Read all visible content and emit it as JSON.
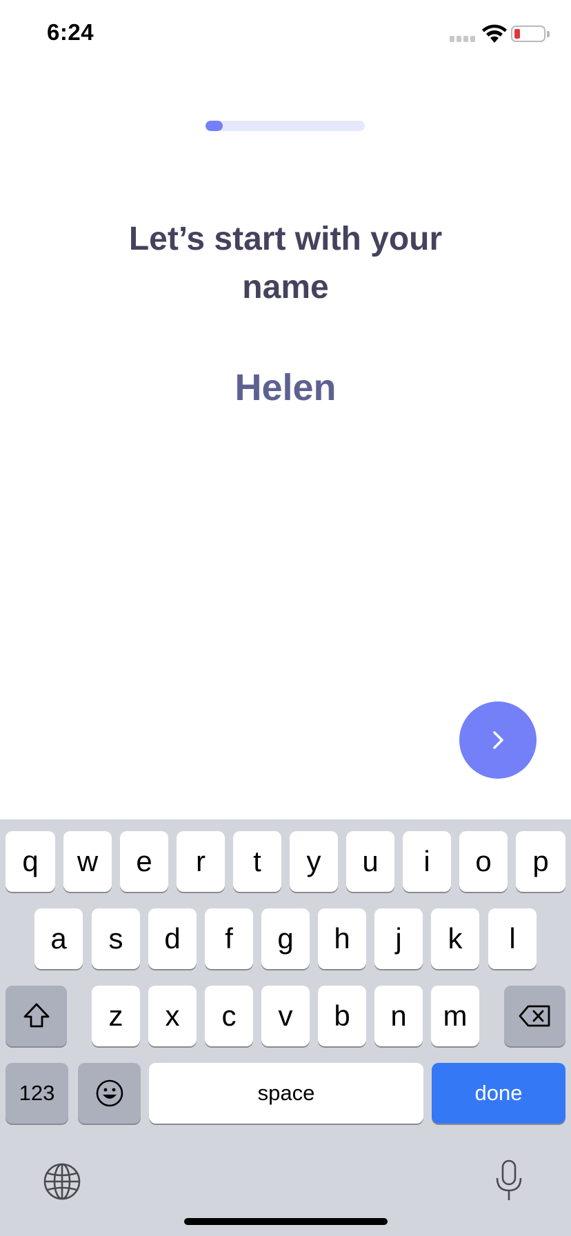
{
  "status_bar": {
    "time": "6:24"
  },
  "onboarding": {
    "progress_fraction": 0.11,
    "headline": "Let’s start with your name",
    "name_value": "Helen"
  },
  "colors": {
    "accent": "#7480f7",
    "progress_track": "#e6e8fb",
    "headline": "#43435e",
    "input_text": "#5e6190",
    "keyboard_bg": "#d3d5dc",
    "done_key": "#3478f6",
    "battery_low": "#e0383a"
  },
  "icons": {
    "next": "chevron-right-icon",
    "shift": "shift-icon",
    "delete": "backspace-icon",
    "emoji": "emoji-icon",
    "globe": "globe-icon",
    "mic": "microphone-icon"
  },
  "keyboard": {
    "row1": [
      "q",
      "w",
      "e",
      "r",
      "t",
      "y",
      "u",
      "i",
      "o",
      "p"
    ],
    "row2": [
      "a",
      "s",
      "d",
      "f",
      "g",
      "h",
      "j",
      "k",
      "l"
    ],
    "row3": [
      "z",
      "x",
      "c",
      "v",
      "b",
      "n",
      "m"
    ],
    "numbers_label": "123",
    "space_label": "space",
    "done_label": "done"
  }
}
